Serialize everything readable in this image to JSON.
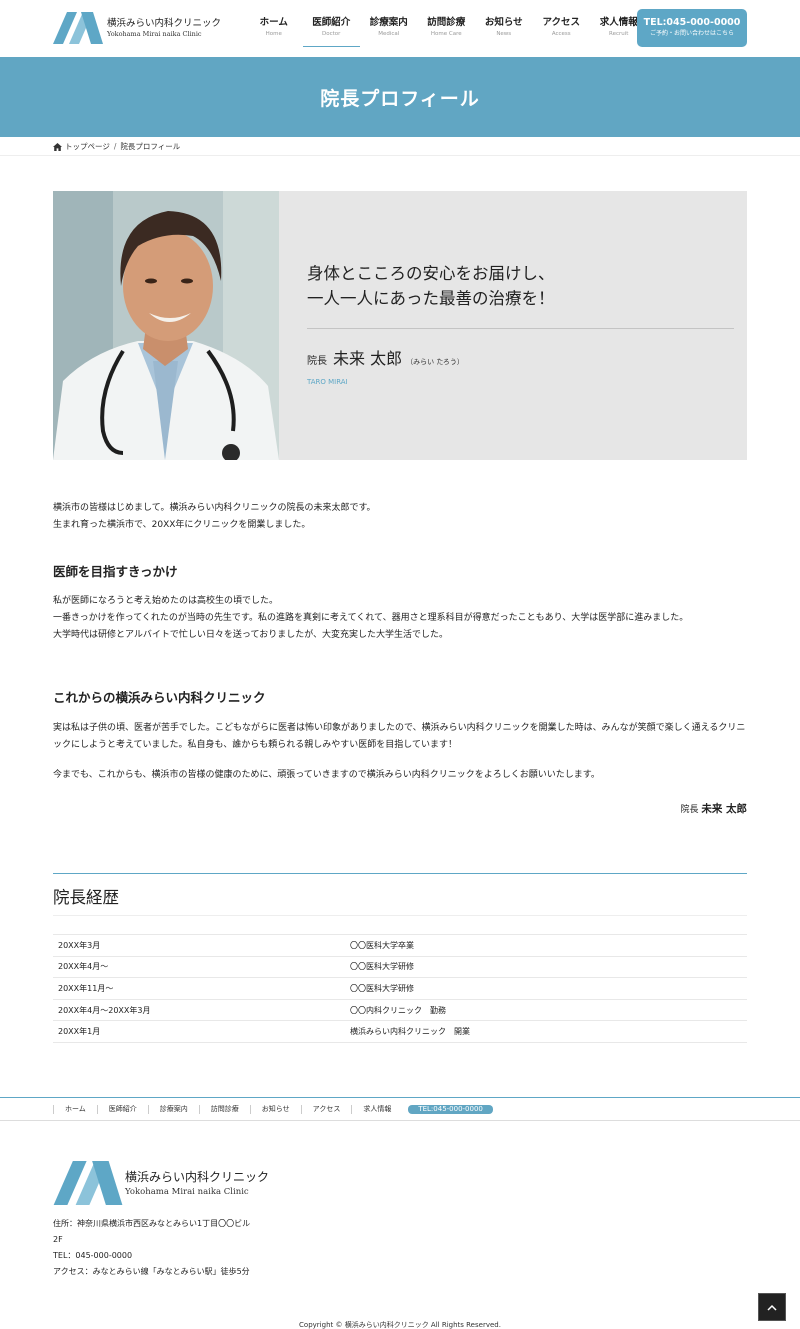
{
  "header": {
    "logo_jp": "横浜みらい内科クリニック",
    "logo_en": "Yokohama Mirai naika Clinic",
    "nav": [
      {
        "jp": "ホーム",
        "en": "Home"
      },
      {
        "jp": "医師紹介",
        "en": "Doctor"
      },
      {
        "jp": "診療案内",
        "en": "Medical"
      },
      {
        "jp": "訪問診療",
        "en": "Home Care"
      },
      {
        "jp": "お知らせ",
        "en": "News"
      },
      {
        "jp": "アクセス",
        "en": "Access"
      },
      {
        "jp": "求人情報",
        "en": "Recruit"
      }
    ],
    "tel": "TEL:045-000-0000",
    "tel_sub": "ご予約・お問い合わせはこちら"
  },
  "page_title": "院長プロフィール",
  "breadcrumb": {
    "home": "トップページ",
    "sep": "/",
    "current": "院長プロフィール"
  },
  "profile": {
    "catch": "身体とこころの安心をお届けし、\n一人一人にあった最善の治療を！",
    "title": "院長",
    "name": "未来 太郎",
    "kana": "（みらい たろう）",
    "name_en": "TARO MIRAI"
  },
  "intro": {
    "line1": "横浜市の皆様はじめまして。横浜みらい内科クリニックの院長の未来太郎です。",
    "line2": "生まれ育った横浜市で、20XX年にクリニックを開業しました。"
  },
  "section1": {
    "heading": "医師を目指すきっかけ",
    "line1": "私が医師になろうと考え始めたのは高校生の頃でした。",
    "line2": "一番きっかけを作ってくれたのが当時の先生です。私の進路を真剣に考えてくれて、器用さと理系科目が得意だったこともあり、大学は医学部に進みました。",
    "line3": "大学時代は研修とアルバイトで忙しい日々を送っておりましたが、大変充実した大学生活でした。"
  },
  "section2": {
    "heading": "これからの横浜みらい内科クリニック",
    "para1": "実は私は子供の頃、医者が苦手でした。こどもながらに医者は怖い印象がありましたので、横浜みらい内科クリニックを開業した時は、みんなが笑顔で楽しく通えるクリニックにしようと考えていました。私自身も、誰からも頼られる親しみやすい医師を目指しています！",
    "para2": "今までも、これからも、横浜市の皆様の健康のために、頑張っていきますので横浜みらい内科クリニックをよろしくお願いいたします。",
    "sign_title": "院長",
    "sign_name": "未来 太郎"
  },
  "history": {
    "title": "院長経歴",
    "rows": [
      {
        "date": "20XX年3月",
        "desc": "〇〇医科大学卒業"
      },
      {
        "date": "20XX年4月～",
        "desc": "〇〇医科大学研修"
      },
      {
        "date": "20XX年11月～",
        "desc": "〇〇医科大学研修"
      },
      {
        "date": "20XX年4月～20XX年3月",
        "desc": "〇〇内科クリニック　勤務"
      },
      {
        "date": "20XX年1月",
        "desc": "横浜みらい内科クリニック　開業"
      }
    ]
  },
  "footer_nav": {
    "items": [
      "ホーム",
      "医師紹介",
      "診療案内",
      "訪問診療",
      "お知らせ",
      "アクセス",
      "求人情報"
    ],
    "tel": "TEL:045-000-0000"
  },
  "footer": {
    "logo_jp": "横浜みらい内科クリニック",
    "logo_en": "Yokohama Mirai naika Clinic",
    "address_line1": "住所：神奈川県横浜市西区みなとみらい1丁目〇〇ビル",
    "address_line2": "2F",
    "tel": "TEL：045-000-0000",
    "access": "アクセス：みなとみらい線「みなとみらい駅」徒歩5分",
    "copyright": "Copyright © 横浜みらい内科クリニック All Rights Reserved."
  },
  "colors": {
    "accent": "#5ea7c6",
    "band": "#61a6c3",
    "card_bg": "#e6e6e6"
  },
  "icons": {
    "breadcrumb_home": "home-icon",
    "pagetop": "chevron-up-icon"
  }
}
